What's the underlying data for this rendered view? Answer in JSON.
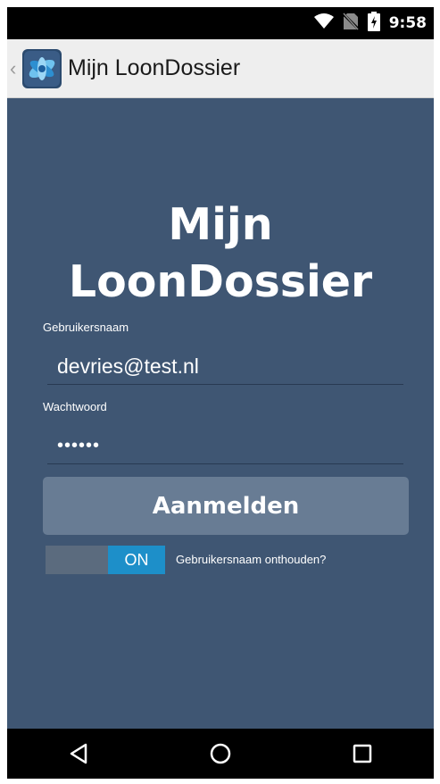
{
  "status_bar": {
    "time": "9:58",
    "icons": [
      "wifi-icon",
      "no-sim-icon",
      "battery-charging-icon"
    ]
  },
  "action_bar": {
    "title": "Mijn LoonDossier",
    "icons": [
      "up-caret-icon",
      "app-logo-icon"
    ]
  },
  "login": {
    "heading_line1": "Mijn",
    "heading_line2": "LoonDossier",
    "username_label": "Gebruikersnaam",
    "username_value": "devries@test.nl",
    "password_label": "Wachtwoord",
    "password_value": "••••••",
    "submit_label": "Aanmelden",
    "remember_toggle": "ON",
    "remember_label": "Gebruikersnaam onthouden?"
  },
  "nav_bar": {
    "icons": [
      "back-icon",
      "home-icon",
      "recents-icon"
    ]
  }
}
